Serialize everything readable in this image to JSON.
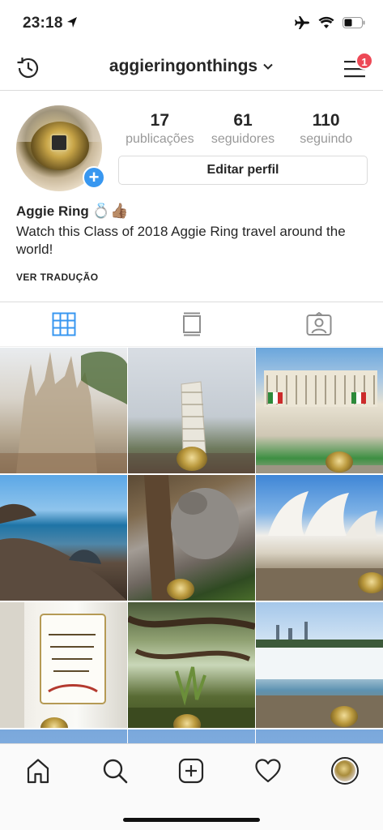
{
  "status_bar": {
    "time": "23:18"
  },
  "nav": {
    "username": "aggieringonthings",
    "notification_count": "1"
  },
  "profile": {
    "stats": [
      {
        "value": "17",
        "label": "publicações"
      },
      {
        "value": "61",
        "label": "seguidores"
      },
      {
        "value": "110",
        "label": "seguindo"
      }
    ],
    "edit_button": "Editar perfil",
    "name": "Aggie Ring",
    "name_emojis": "💍👍🏽",
    "bio": "Watch this Class of 2018 Aggie Ring travel around the world!",
    "translate": "VER TRADUÇÃO"
  },
  "tabs": [
    {
      "icon": "grid-icon",
      "active": true
    },
    {
      "icon": "feed-icon",
      "active": false
    },
    {
      "icon": "tagged-icon",
      "active": false
    }
  ],
  "colors": {
    "accent": "#3897f0",
    "badge": "#ed4956",
    "text": "#262626",
    "muted": "#999999",
    "border": "#dbdbdb"
  },
  "bottom_nav": [
    "home-icon",
    "search-icon",
    "new-post-icon",
    "heart-icon",
    "profile-avatar"
  ]
}
